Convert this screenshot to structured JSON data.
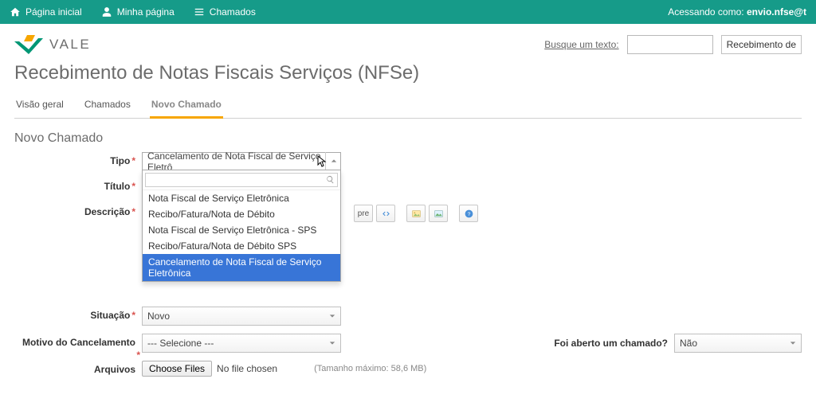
{
  "topbar": {
    "nav": {
      "home": "Página inicial",
      "mypage": "Minha página",
      "tickets": "Chamados"
    },
    "accessing_as_label": "Acessando como:",
    "accessing_as_user": "envio.nfse@t"
  },
  "header": {
    "brand": "VALE",
    "search_label": "Busque um texto:",
    "search_value": "",
    "extra_box": "Recebimento de",
    "page_title": "Recebimento de Notas Fiscais Serviços (NFSe)"
  },
  "tabs": {
    "overview": "Visão geral",
    "tickets": "Chamados",
    "new_ticket": "Novo Chamado"
  },
  "section_title": "Novo Chamado",
  "form": {
    "tipo": {
      "label": "Tipo",
      "selected": "Cancelamento de Nota Fiscal de Serviço Eletrô",
      "options": [
        "Nota Fiscal de Serviço Eletrônica",
        "Recibo/Fatura/Nota de Débito",
        "Nota Fiscal de Serviço Eletrônica - SPS",
        "Recibo/Fatura/Nota de Débito SPS",
        "Cancelamento de Nota Fiscal de Serviço Eletrônica"
      ]
    },
    "titulo": {
      "label": "Título"
    },
    "descricao": {
      "label": "Descrição"
    },
    "situacao": {
      "label": "Situação",
      "value": "Novo"
    },
    "motivo": {
      "label": "Motivo do Cancelamento",
      "value": "--- Selecione ---"
    },
    "foi_aberto": {
      "label": "Foi aberto um chamado?",
      "value": "Não"
    },
    "arquivos": {
      "label": "Arquivos",
      "button": "Choose Files",
      "status": "No file chosen",
      "hint": "(Tamanho máximo: 58,6 MB)"
    }
  },
  "toolbar": {
    "pre": "pre"
  }
}
